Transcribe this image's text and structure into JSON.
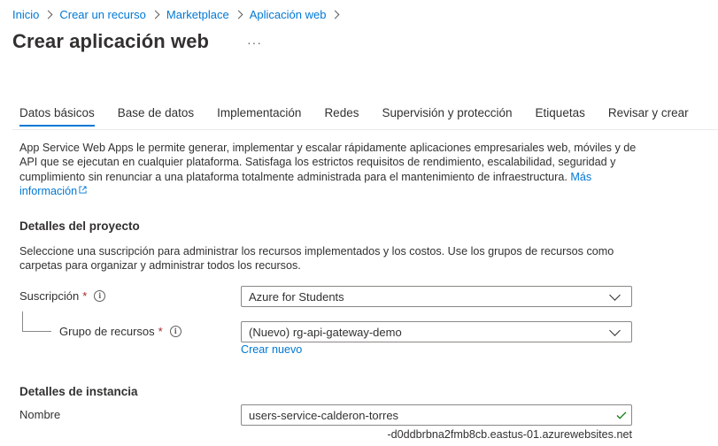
{
  "breadcrumb": {
    "items": [
      "Inicio",
      "Crear un recurso",
      "Marketplace",
      "Aplicación web"
    ]
  },
  "header": {
    "title": "Crear aplicación web",
    "more": "···"
  },
  "tabs": [
    {
      "label": "Datos básicos",
      "active": true
    },
    {
      "label": "Base de datos"
    },
    {
      "label": "Implementación"
    },
    {
      "label": "Redes"
    },
    {
      "label": "Supervisión y protección"
    },
    {
      "label": "Etiquetas"
    },
    {
      "label": "Revisar y crear"
    }
  ],
  "intro": {
    "text": "App Service Web Apps le permite generar, implementar y escalar rápidamente aplicaciones empresariales web, móviles y de API que se ejecutan en cualquier plataforma. Satisfaga los estrictos requisitos de rendimiento, escalabilidad, seguridad y cumplimiento sin renunciar a una plataforma totalmente administrada para el mantenimiento de infraestructura.",
    "link": "Más información"
  },
  "project_details": {
    "title": "Detalles del proyecto",
    "description": "Seleccione una suscripción para administrar los recursos implementados y los costos. Use los grupos de recursos como carpetas para organizar y administrar todos los recursos.",
    "subscription": {
      "label": "Suscripción",
      "required": "*",
      "value": "Azure for Students"
    },
    "resource_group": {
      "label": "Grupo de recursos",
      "required": "*",
      "value": "(Nuevo) rg-api-gateway-demo",
      "create_new": "Crear nuevo"
    }
  },
  "instance_details": {
    "title": "Detalles de instancia",
    "name": {
      "label": "Nombre",
      "value": "users-service-calderon-torres",
      "suffix": "-d0ddbrbna2fmb8cb.eastus-01.azurewebsites.net"
    }
  },
  "colors": {
    "accent": "#0078d4",
    "required": "#a4262c",
    "valid": "#107c10"
  },
  "icons": {
    "info": "info-icon",
    "external": "external-link-icon",
    "chevron": "chevron-down-icon",
    "check": "check-icon"
  }
}
